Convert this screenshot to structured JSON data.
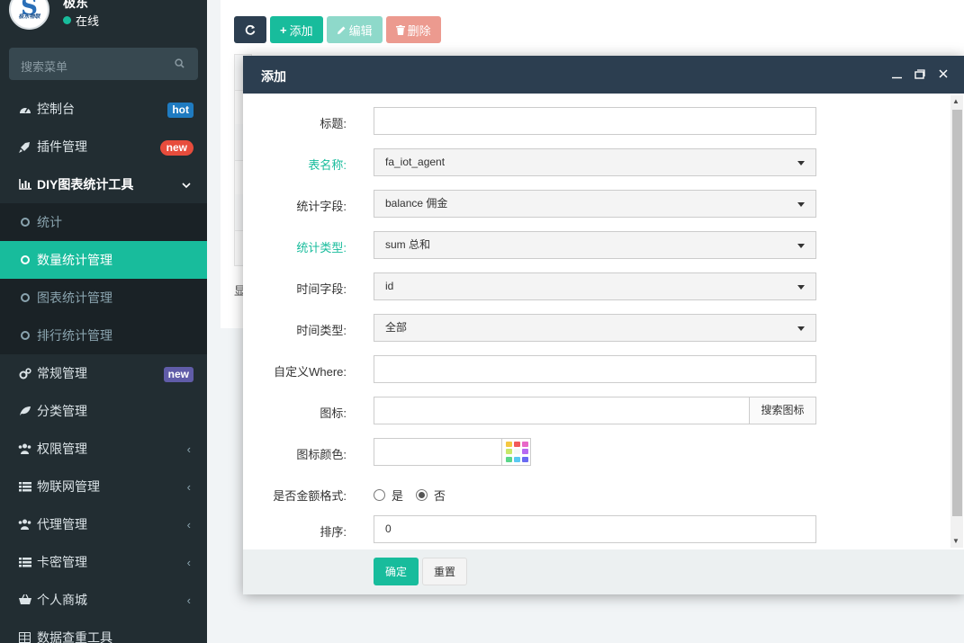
{
  "colors": {
    "sidebar_bg": "#222d32",
    "accent": "#18bc9c",
    "header_dark": "#2c3e50",
    "danger": "#e74c3c",
    "info": "#1f7bc1",
    "purple": "#605ca8"
  },
  "user": {
    "name": "极东",
    "status": "在线",
    "logo_text": "极东物联",
    "avatar_icon": "logo-s"
  },
  "sidebar_search": {
    "placeholder": "搜索菜单",
    "icon": "search-icon"
  },
  "menu": [
    {
      "label": "控制台",
      "icon": "dashboard-icon",
      "badge": "hot"
    },
    {
      "label": "插件管理",
      "icon": "rocket-icon",
      "badge": "new"
    },
    {
      "label": "DIY图表统计工具",
      "icon": "bar-chart-icon",
      "expanded": true
    },
    {
      "label": "统计",
      "icon": "circle-o-icon",
      "sub": true
    },
    {
      "label": "数量统计管理",
      "icon": "circle-o-icon",
      "sub": true,
      "active": true
    },
    {
      "label": "图表统计管理",
      "icon": "circle-o-icon",
      "sub": true
    },
    {
      "label": "排行统计管理",
      "icon": "circle-o-icon",
      "sub": true
    },
    {
      "label": "常规管理",
      "icon": "cogs-icon",
      "badge": "new"
    },
    {
      "label": "分类管理",
      "icon": "leaf-icon"
    },
    {
      "label": "权限管理",
      "icon": "group-icon"
    },
    {
      "label": "物联网管理",
      "icon": "list-icon"
    },
    {
      "label": "代理管理",
      "icon": "group-icon"
    },
    {
      "label": "卡密管理",
      "icon": "list-icon"
    },
    {
      "label": "个人商城",
      "icon": "basket-icon"
    },
    {
      "label": "数据查重工具",
      "icon": "table-icon"
    }
  ],
  "toolbar": {
    "refresh_icon": "refresh-icon",
    "add": "添加",
    "edit": "编辑",
    "delete": "删除"
  },
  "table_partial_text": "显",
  "modal": {
    "title": "添加",
    "fields": {
      "title_label": "标题:",
      "table_label": "表名称:",
      "table_value": "fa_iot_agent",
      "stat_field_label": "统计字段:",
      "stat_field_value": "balance 佣金",
      "stat_type_label": "统计类型:",
      "stat_type_value": "sum 总和",
      "time_field_label": "时间字段:",
      "time_field_value": "id",
      "time_type_label": "时间类型:",
      "time_type_value": "全部",
      "where_label": "自定义Where:",
      "icon_label": "图标:",
      "icon_search_button": "搜索图标",
      "icon_color_label": "图标颜色:",
      "money_format_label": "是否金额格式:",
      "money_yes": "是",
      "money_no": "否",
      "money_selected": "否",
      "sort_label": "排序:",
      "sort_value": "0"
    },
    "confirm_button": "确定",
    "reset_button": "重置"
  }
}
